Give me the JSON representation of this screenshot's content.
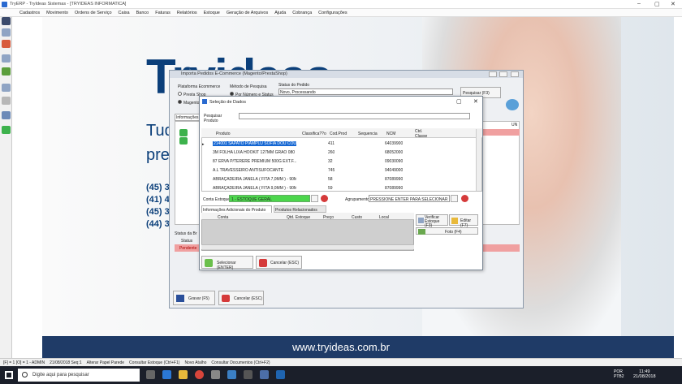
{
  "window": {
    "title": "TryERP - TryIdeas Sistemas - [TRYIDEAS INFORMATICA]"
  },
  "menu": [
    "Cadastros",
    "Movimento",
    "Ordens de Serviço",
    "Caixa",
    "Banco",
    "Faturas",
    "Relatórios",
    "Estoque",
    "Geração de Arquivos",
    "Ajuda",
    "Cobrança",
    "Configurações"
  ],
  "background": {
    "logo": "Tryideas",
    "line1": "Tud",
    "line2": "pre",
    "phones": [
      "(45) 3",
      "(41) 4",
      "(45) 3",
      "(44) 3"
    ],
    "footer": "www.tryideas.com.br"
  },
  "mainDialog": {
    "title": "Importa Pedidos E-Commerce (Magento/PrestaShop)",
    "platformLabel": "Plataforma Ecommerce",
    "platformOpt1": "Presta Shop",
    "platformOpt2": "Magento",
    "searchMethodLabel": "Método de Pesquisa",
    "searchMethodOpt": "Por Número e Status",
    "orderStatusLabel": "Status do Pedido",
    "orderStatusValue": "Novo, Processando",
    "searchButton": "Pesquisar (F3)",
    "infoTab": "Informações",
    "statusLabel": "Status da Br",
    "statusCol": "Status",
    "statusRow": "Pendente",
    "unCol": "UN",
    "saveButton": "Gravar (F5)",
    "cancelButton": "Cancelar (ESC)"
  },
  "selDialog": {
    "title": "Seleção de Dados",
    "searchLabel": "Pesquisar Produto",
    "columns": [
      "Produto",
      "Classifica??o",
      "Cod.Prod",
      "Sequencia",
      "NCM",
      "Ctd. Classe"
    ],
    "rows": [
      {
        "produto": "214001 SAPATO PIAMPLU SOFIA DOU COUR",
        "cod": "411",
        "ncm": "64039900"
      },
      {
        "produto": "3M FOLHA LIXA HOOKIT 127MM GRAO 080",
        "cod": "260",
        "ncm": "68052000"
      },
      {
        "produto": "87 ERVA P/TERERE PREMIUM 500G EXT.F...",
        "cod": "32",
        "ncm": "09030090"
      },
      {
        "produto": "A.L TRAVESSEIRO ANTISUFOCANTE",
        "cod": "745",
        "ncm": "94049000"
      },
      {
        "produto": "ABRAÇADEIRA JANELA ( FITA 7,0MM ) - 90M...",
        "cod": "58",
        "ncm": "87089990"
      },
      {
        "produto": "ABRAÇADEIRA JANELA ( FITA 9,0MM ) - 90M...",
        "cod": "59",
        "ncm": "87089990"
      }
    ],
    "stockLabel": "Conta Estoque",
    "stockValue": "1 - ESTOQUE GERAL",
    "groupLabel": "Agrupamento",
    "groupValue": "PRESSIONE ENTER PARA SELECIONAR O AGRU",
    "tab1": "Informações Adicionais do Produto (F1)",
    "tab2": "Produtos Relacionados (F2)",
    "subColumns": [
      "Conta",
      "Qtd. Estoque",
      "Preço",
      "Custo",
      "Local"
    ],
    "checkStock": "Verificar Estoque (F3)",
    "editButton": "Editar (F7)",
    "photoButton": "Foto (F4)",
    "selectButton": "Selecionar (ENTER)",
    "cancelButton": "Cancelar (ESC)"
  },
  "statusBar": [
    "[F] = 1 [O] = 1 - ADMIN",
    "21/08/2018 Seq:1",
    "Alterar Papel Parede",
    "Consultar Estoque (Ctrl+F1)",
    "Novo Atalho",
    "Consultar Documentos (Ctrl+F2)"
  ],
  "taskbar": {
    "searchPlaceholder": "Digite aqui para pesquisar",
    "lang": "POR\nPTB2",
    "time": "11:49",
    "date": "21/08/2018"
  },
  "colors": {
    "accentBlue": "#1567d3",
    "green": "#4cd64c",
    "navy": "#0b3f7a",
    "taskbar": "#1b1f2a",
    "pink": "#f0a0a0"
  }
}
